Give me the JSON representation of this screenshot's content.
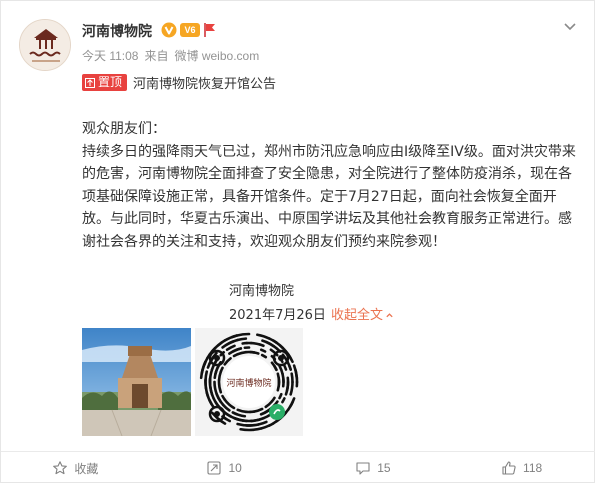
{
  "post": {
    "author": "河南博物院",
    "timestamp": "今天 11:08",
    "source_prefix": "来自",
    "source": "微博 weibo.com",
    "level_badge": "V6",
    "pinned_label": "置顶",
    "pinned_title": "河南博物院恢复开馆公告",
    "greeting": "观众朋友们：",
    "body": "持续多日的强降雨天气已过，郑州市防汛应急响应由I级降至IV级。面对洪灾带来的危害，河南博物院全面排查了安全隐患，对全院进行了整体防疫消杀，现在各项基础保障设施正常，具备开馆条件。定于7月27日起，面向社会恢复全面开放。与此同时，华夏古乐演出、中原国学讲坛及其他社会教育服务正常进行。感谢社会各界的关注和支持，欢迎观众朋友们预约来院参观！",
    "signature_name": "河南博物院",
    "signature_date": "2021年7月26日",
    "collapse_label": "收起全文",
    "qr_center_text": "河南博物院"
  },
  "footer": {
    "favorite_label": "收藏",
    "repost_count": "10",
    "comment_count": "15",
    "like_count": "118"
  },
  "icons": [
    "verified-icon",
    "level-badge-icon",
    "flag-icon",
    "chevron-down-icon",
    "pin-icon",
    "star-icon",
    "repost-icon",
    "comment-icon",
    "like-icon",
    "collapse-arrow-icon"
  ],
  "colors": {
    "accent_orange": "#eb7350",
    "pin_red": "#e8423f",
    "verified_gold": "#f6a623",
    "muted_text": "#939393"
  }
}
